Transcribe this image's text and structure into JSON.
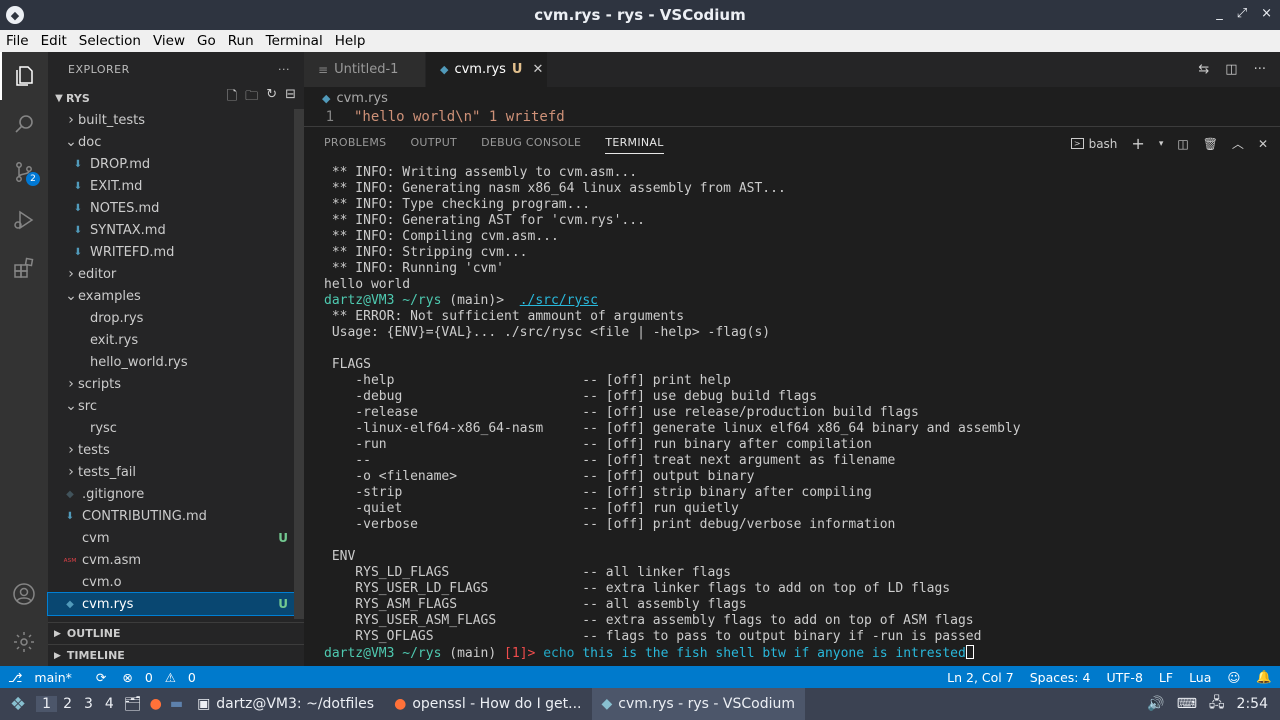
{
  "window": {
    "title": "cvm.rys - rys - VSCodium",
    "controls": [
      "_",
      "⤢",
      "×"
    ]
  },
  "menu": [
    "File",
    "Edit",
    "Selection",
    "View",
    "Go",
    "Run",
    "Terminal",
    "Help"
  ],
  "activity": {
    "scm_badge": "2"
  },
  "explorer": {
    "title": "EXPLORER",
    "more": "···",
    "root": "RYS",
    "items": [
      {
        "label": "built_tests",
        "depth": 1,
        "kind": "folder-closed"
      },
      {
        "label": "doc",
        "depth": 1,
        "kind": "folder-open"
      },
      {
        "label": "DROP.md",
        "depth": 2,
        "kind": "md"
      },
      {
        "label": "EXIT.md",
        "depth": 2,
        "kind": "md"
      },
      {
        "label": "NOTES.md",
        "depth": 2,
        "kind": "md"
      },
      {
        "label": "SYNTAX.md",
        "depth": 2,
        "kind": "md"
      },
      {
        "label": "WRITEFD.md",
        "depth": 2,
        "kind": "md"
      },
      {
        "label": "editor",
        "depth": 1,
        "kind": "folder-closed"
      },
      {
        "label": "examples",
        "depth": 1,
        "kind": "folder-open"
      },
      {
        "label": "drop.rys",
        "depth": 2,
        "kind": "file"
      },
      {
        "label": "exit.rys",
        "depth": 2,
        "kind": "file"
      },
      {
        "label": "hello_world.rys",
        "depth": 2,
        "kind": "file"
      },
      {
        "label": "scripts",
        "depth": 1,
        "kind": "folder-closed"
      },
      {
        "label": "src",
        "depth": 1,
        "kind": "folder-open"
      },
      {
        "label": "rysc",
        "depth": 2,
        "kind": "file"
      },
      {
        "label": "tests",
        "depth": 1,
        "kind": "folder-closed"
      },
      {
        "label": "tests_fail",
        "depth": 1,
        "kind": "folder-closed"
      },
      {
        "label": ".gitignore",
        "depth": 1,
        "kind": "gitignore"
      },
      {
        "label": "CONTRIBUTING.md",
        "depth": 1,
        "kind": "md"
      },
      {
        "label": "cvm",
        "depth": 1,
        "kind": "file",
        "status": "U"
      },
      {
        "label": "cvm.asm",
        "depth": 1,
        "kind": "asm"
      },
      {
        "label": "cvm.o",
        "depth": 1,
        "kind": "file"
      },
      {
        "label": "cvm.rys",
        "depth": 1,
        "kind": "rys",
        "status": "U",
        "selected": true
      }
    ],
    "outline": "OUTLINE",
    "timeline": "TIMELINE"
  },
  "tabs": [
    {
      "label": "Untitled-1",
      "active": false
    },
    {
      "label": "cvm.rys",
      "active": true,
      "status": "U"
    }
  ],
  "breadcrumb": "cvm.rys",
  "code": {
    "line": "1",
    "text": "\"hello world\\n\" 1 writefd"
  },
  "panel": {
    "tabs": [
      "PROBLEMS",
      "OUTPUT",
      "DEBUG CONSOLE",
      "TERMINAL"
    ],
    "active_tab": "TERMINAL",
    "shell": "bash"
  },
  "terminal": {
    "lines_a": [
      " ** INFO: Writing assembly to cvm.asm...",
      " ** INFO: Generating nasm x86_64 linux assembly from AST...",
      " ** INFO: Type checking program...",
      " ** INFO: Generating AST for 'cvm.rys'...",
      " ** INFO: Compiling cvm.asm...",
      " ** INFO: Stripping cvm...",
      " ** INFO: Running 'cvm'",
      "hello world"
    ],
    "prompt_user": "dartz@VM3",
    "prompt_path": "~/rys",
    "prompt_branch": "(main)>",
    "cmd1": "./src/rysc",
    "lines_b": [
      " ** ERROR: Not sufficient ammount of arguments",
      " Usage: {ENV}={VAL}... ./src/rysc <file | -help> -flag(s)",
      "",
      " FLAGS",
      "    -help                        -- [off] print help",
      "    -debug                       -- [off] use debug build flags",
      "    -release                     -- [off] use release/production build flags",
      "    -linux-elf64-x86_64-nasm     -- [off] generate linux elf64 x86_64 binary and assembly",
      "    -run                         -- [off] run binary after compilation",
      "    --                           -- [off] treat next argument as filename",
      "    -o <filename>                -- [off] output binary",
      "    -strip                       -- [off] strip binary after compiling",
      "    -quiet                       -- [off] run quietly",
      "    -verbose                     -- [off] print debug/verbose information",
      "",
      " ENV",
      "    RYS_LD_FLAGS                 -- all linker flags",
      "    RYS_USER_LD_FLAGS            -- extra linker flags to add on top of LD flags",
      "    RYS_ASM_FLAGS                -- all assembly flags",
      "    RYS_USER_ASM_FLAGS           -- extra assembly flags to add on top of ASM flags",
      "    RYS_OFLAGS                   -- flags to pass to output binary if -run is passed"
    ],
    "prompt_branch2": "(main)",
    "exit_code": "[1]>",
    "cmd2_kw": "echo",
    "cmd2_args": "this is the fish shell btw if anyone is intrested"
  },
  "status": {
    "branch": "main*",
    "errors": "0",
    "warnings": "0",
    "position": "Ln 2, Col 7",
    "spaces": "Spaces: 4",
    "encoding": "UTF-8",
    "eol": "LF",
    "language": "Lua"
  },
  "taskbar": {
    "workspaces": [
      "1",
      "2",
      "3",
      "4"
    ],
    "apps": [
      {
        "label": "dartz@VM3: ~/dotfiles",
        "icon": "terminal-icon"
      },
      {
        "label": "openssl - How do I get...",
        "icon": "firefox-icon"
      },
      {
        "label": "cvm.rys - rys - VSCodium",
        "icon": "vscodium-icon",
        "active": true
      }
    ],
    "clock": "2:54"
  }
}
